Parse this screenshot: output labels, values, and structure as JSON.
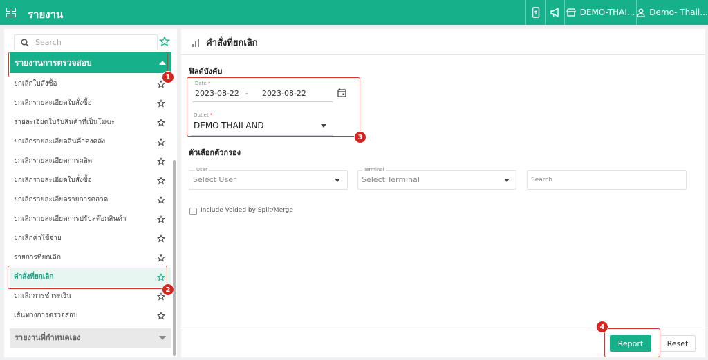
{
  "header": {
    "app_title": "รายงาน",
    "outlet_label": "DEMO-THAI...",
    "user_label": "Demo- Thail..."
  },
  "sidebar": {
    "search_placeholder": "Search",
    "group_title": "รายงานการตรวจสอบ",
    "items": [
      {
        "label": "ยกเลิกใบสั่งซื้อ"
      },
      {
        "label": "ยกเลิกรายละเอียดใบสั่งซื้อ"
      },
      {
        "label": "รายละเอียดใบรับสินค้าที่เป็นโมฆะ"
      },
      {
        "label": "ยกเลิกรายละเอียดสินค้าคงคลัง"
      },
      {
        "label": "ยกเลิกรายละเอียดการผลิต"
      },
      {
        "label": "ยกเลิกรายละเอียดใบสั่งซื้อ"
      },
      {
        "label": "ยกเลิกรายละเอียดรายการตลาด"
      },
      {
        "label": "ยกเลิกรายละเอียดการปรับสต๊อกสินค้า"
      },
      {
        "label": "ยกเลิกค่าใช้จ่าย"
      },
      {
        "label": "รายการที่ยกเลิก"
      },
      {
        "label": "คำสั่งที่ยกเลิก",
        "active": true
      },
      {
        "label": "ยกเลิกการชำระเงิน"
      },
      {
        "label": "เส้นทางการตรวจสอบ"
      }
    ],
    "footer_group_title": "รายงานที่กำหนดเอง"
  },
  "main": {
    "page_title": "คำสั่งที่ยกเลิก",
    "required_section": "ฟิลด์บังคับ",
    "date_label": "Date",
    "date_required_mark": "*",
    "date_from": "2023-08-22",
    "date_separator": "-",
    "date_to": "2023-08-22",
    "outlet_label": "Outlet",
    "outlet_required_mark": "*",
    "outlet_value": "DEMO-THAILAND",
    "filter_section": "ตัวเลือกตัวกรอง",
    "user_label": "User",
    "user_placeholder": "Select User",
    "terminal_label": "Terminal",
    "terminal_placeholder": "Select Terminal",
    "search_placeholder": "Search",
    "include_voided_label": "Include Voided by Split/Merge",
    "report_button": "Report",
    "reset_button": "Reset"
  },
  "annotations": {
    "badge_1": "1",
    "badge_2": "2",
    "badge_3": "3",
    "badge_4": "4"
  },
  "colors": {
    "brand": "#16b08a",
    "highlight": "#e0302a",
    "active_item_bg": "#e7f6f1"
  }
}
